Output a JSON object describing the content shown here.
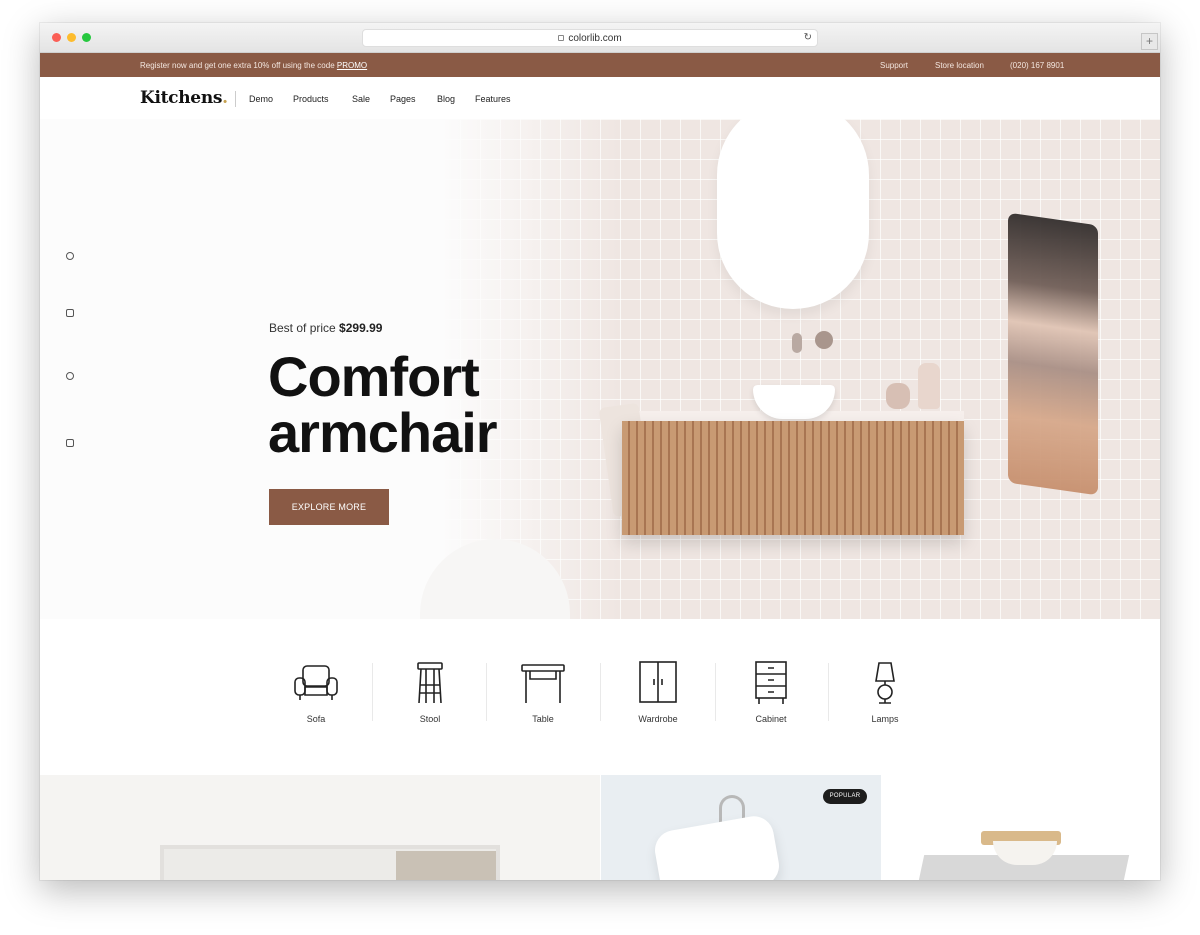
{
  "browser": {
    "url": "colorlib.com"
  },
  "topbar": {
    "promo_text": "Register now and get one extra 10% off using the code",
    "promo_code": "PROMO",
    "links": [
      "Support",
      "Store location",
      "(020) 167 8901"
    ]
  },
  "nav": {
    "logo": "Kitchens",
    "logo_dot": ".",
    "items": [
      "Demo",
      "Products",
      "Sale",
      "Pages",
      "Blog",
      "Features"
    ]
  },
  "hero": {
    "price_label": "Best of price",
    "price_value": "$299.99",
    "title_line1": "Comfort",
    "title_line2": "armchair",
    "button_label": "EXPLORE MORE"
  },
  "categories": [
    "Sofa",
    "Stool",
    "Table",
    "Wardrobe",
    "Cabinet",
    "Lamps"
  ],
  "products": {
    "badge": "POPULAR"
  },
  "colors": {
    "brand": "#8a5a45",
    "logo_accent": "#c7a250"
  },
  "icons": [
    "lock-icon",
    "reload-icon",
    "newtab-icon",
    "social-icon",
    "sofa-icon",
    "stool-icon",
    "table-icon",
    "wardrobe-icon",
    "cabinet-icon",
    "lamp-icon"
  ]
}
